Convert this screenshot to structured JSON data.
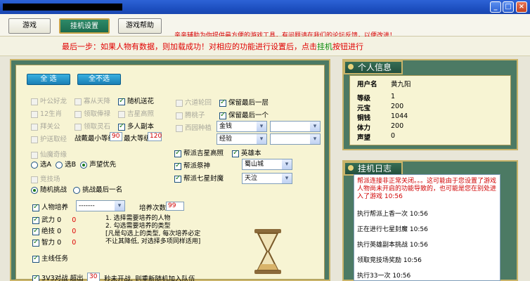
{
  "window": {
    "buttons": [
      "_",
      "□",
      "×"
    ]
  },
  "menu": {
    "tabs": [
      "游戏",
      "挂机设置",
      "游戏帮助"
    ],
    "active": 1,
    "notice": "亲亲辅助为你提供最方便的游戏工具，有问题请在我们的论坛反馈，以便改进！"
  },
  "step": {
    "text": "最后一步：如果人物有数据，则加载成功！对相应的功能进行设置后，点击",
    "highlight": "挂机",
    "tail": "按钮进行"
  },
  "settings": {
    "select_all": "全  选",
    "select_none": "全不选",
    "left_col": [
      "叶公好龙",
      "12生肖",
      "拜关公",
      "护送取经"
    ],
    "mid_col": [
      "寡从天降",
      "领取俸禄",
      "领取灵石"
    ],
    "right_col": [
      "随机送花",
      "吉星高照",
      "多人副本"
    ],
    "level_min_label": "战戴最小等级",
    "level_min": "90",
    "level_max_label": "最大等级",
    "level_max": "120",
    "col3": [
      "六道轮回",
      "腾桃子",
      "西园种植"
    ],
    "col4": [
      "保留最后一层",
      "保留最后一个"
    ],
    "sel_money": "金钱",
    "sel_exp": "经验",
    "xianmo": "仙魔奇缘",
    "xianmo_opts": [
      "选A",
      "选B",
      "声望优先"
    ],
    "jingji": "竞技场",
    "jingji_opts": [
      "随机挑战",
      "挑战最后一名"
    ],
    "guild": [
      "帮派吉星高照",
      "帮派祭神",
      "帮派七星封魔"
    ],
    "hero": "英雄本",
    "sel_city": "蜀山城",
    "sel_tian": "天泣",
    "cultivate": "人物培养",
    "cult_sel": "-------",
    "cult_times_label": "培养次数",
    "cult_times": "99",
    "attrs": [
      {
        "name": "武力",
        "v": "0",
        "r": "0"
      },
      {
        "name": "绝技",
        "v": "0",
        "r": "0"
      },
      {
        "name": "智力",
        "v": "0",
        "r": "0"
      }
    ],
    "hint": [
      "1. 选择需要培养的人物",
      "2. 勾选需要培养的类型",
      "[凡是勾选上的类型, 每次培养必定",
      "不让其降低, 对选择多项同样适用]"
    ],
    "main_task": "主线任务",
    "pvp": "3V3对战",
    "pvp_pre": "超出",
    "pvp_val": "30",
    "pvp_post": "秒未开战, 则重新随机加入队伍"
  },
  "info": {
    "title": "个人信息",
    "rows": [
      {
        "k": "用户名",
        "v": "黄九阳"
      },
      {
        "k": "等级",
        "v": "1"
      },
      {
        "k": "元宝",
        "v": "200"
      },
      {
        "k": "铜钱",
        "v": "1044"
      },
      {
        "k": "体力",
        "v": "200"
      },
      {
        "k": "声望",
        "v": "0"
      }
    ]
  },
  "log": {
    "title": "挂机日志",
    "notice": "帮派连接非正常关闭。。。这可能由于您设置了游戏人物尚未开启的功能导致的，也可能是您在别处进入了游戏 10:56",
    "lines": [
      "执行帮派上香一次 10:56",
      "正在进行七星封魔 10:56",
      "执行英雄副本挑战 10:56",
      "领取竞技场奖励 10:56",
      "执行33一次 10:56"
    ]
  }
}
